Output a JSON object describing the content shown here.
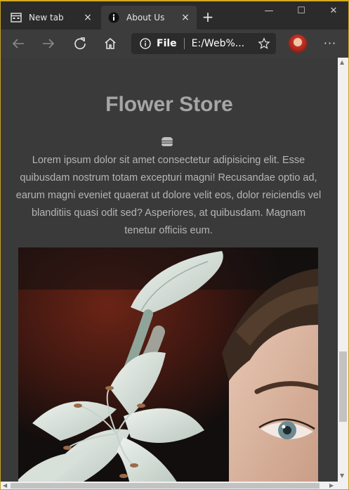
{
  "browser": {
    "tabs": [
      {
        "title": "New tab",
        "active": false,
        "icon": "new-tab-page-icon"
      },
      {
        "title": "About Us",
        "active": true,
        "icon": "info-icon"
      }
    ],
    "new_tab_symbol": "+",
    "close_symbol": "×",
    "window_controls": {
      "minimize": "—",
      "maximize": "☐",
      "close": "✕"
    },
    "address": {
      "scheme": "File",
      "url": "E:/Web%..."
    },
    "more_symbol": "···",
    "accent_color": "#d4aa21"
  },
  "page": {
    "title": "Flower Store",
    "description": "Lorem ipsum dolor sit amet consectetur adipisicing elit. Esse\nquibusdam nostrum totam excepturi magni! Recusandae optio ad,\nearum magni eveniet quaerat ut dolore velit eos, dolor reiciendis vel\nblanditiis quasi odit sed? Asperiores, at quibusdam. Magnam\ntenetur officiis eum.",
    "hero_image": "woman-with-white-lily-photo",
    "background_color": "#3a3a3a",
    "title_color": "#a6a6a6"
  }
}
